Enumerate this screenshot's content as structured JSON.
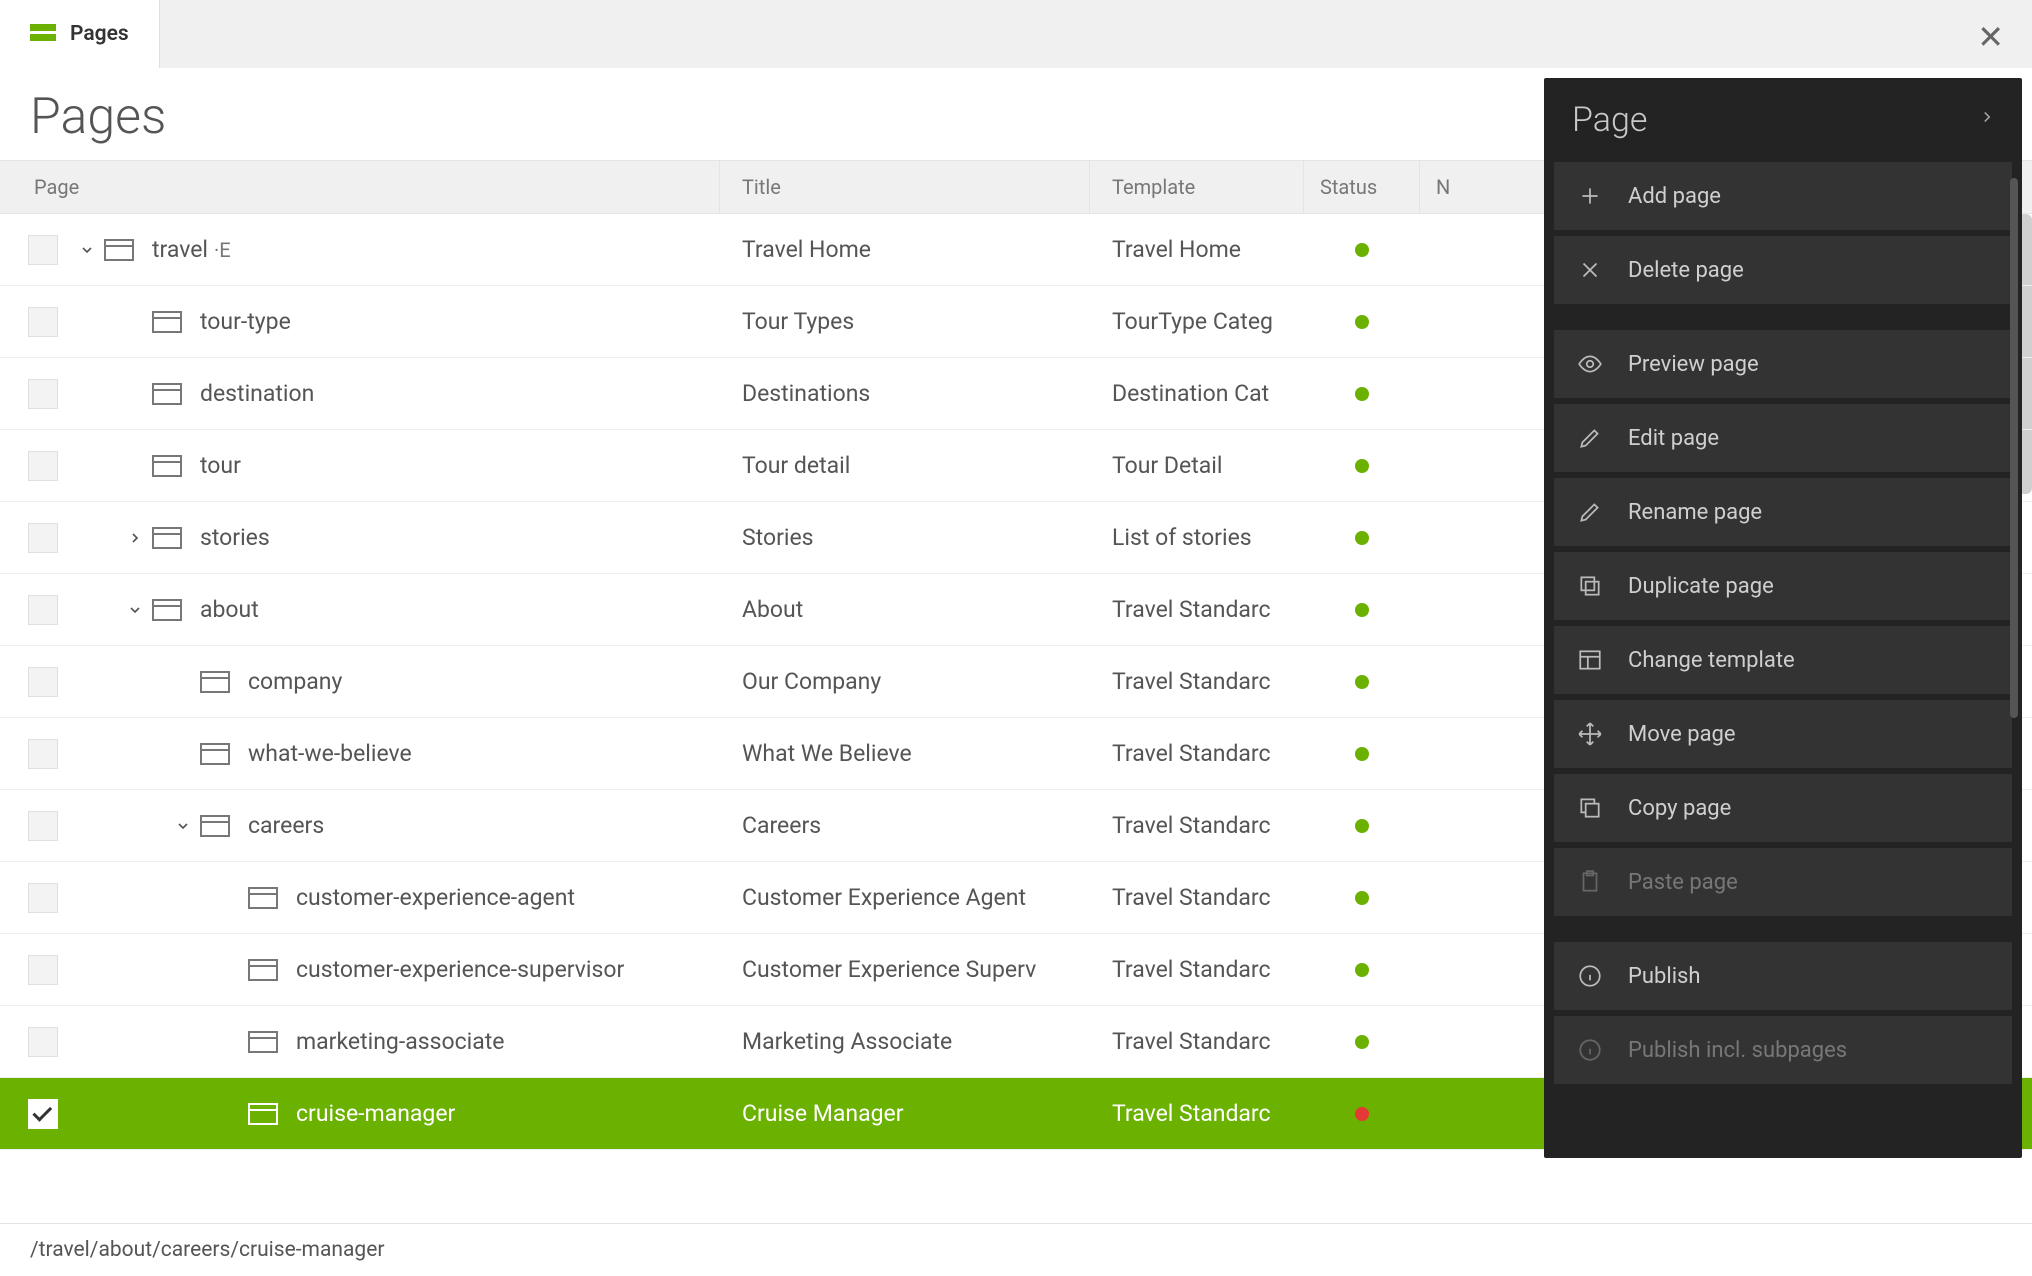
{
  "tab": {
    "label": "Pages"
  },
  "heading": "Pages",
  "columns": {
    "page": "Page",
    "title": "Title",
    "template": "Template",
    "status": "Status",
    "extra": "N"
  },
  "rows": [
    {
      "depth": 0,
      "expander": "down",
      "name": "travel",
      "editing": true,
      "title": "Travel Home",
      "template": "Travel Home",
      "status": "green",
      "selected": false
    },
    {
      "depth": 1,
      "expander": "none",
      "name": "tour-type",
      "title": "Tour Types",
      "template": "TourType Categ",
      "status": "green",
      "selected": false
    },
    {
      "depth": 1,
      "expander": "none",
      "name": "destination",
      "title": "Destinations",
      "template": "Destination Cat",
      "status": "green",
      "selected": false
    },
    {
      "depth": 1,
      "expander": "none",
      "name": "tour",
      "title": "Tour detail",
      "template": "Tour Detail",
      "status": "green",
      "selected": false
    },
    {
      "depth": 1,
      "expander": "right",
      "name": "stories",
      "title": "Stories",
      "template": "List of stories",
      "status": "green",
      "selected": false
    },
    {
      "depth": 1,
      "expander": "down",
      "name": "about",
      "title": "About",
      "template": "Travel Standarc",
      "status": "green",
      "selected": false
    },
    {
      "depth": 2,
      "expander": "none",
      "name": "company",
      "title": "Our Company",
      "template": "Travel Standarc",
      "status": "green",
      "selected": false
    },
    {
      "depth": 2,
      "expander": "none",
      "name": "what-we-believe",
      "title": "What We Believe",
      "template": "Travel Standarc",
      "status": "green",
      "selected": false
    },
    {
      "depth": 2,
      "expander": "down",
      "name": "careers",
      "title": "Careers",
      "template": "Travel Standarc",
      "status": "green",
      "selected": false
    },
    {
      "depth": 3,
      "expander": "none",
      "name": "customer-experience-agent",
      "title": "Customer Experience Agent",
      "template": "Travel Standarc",
      "status": "green",
      "selected": false
    },
    {
      "depth": 3,
      "expander": "none",
      "name": "customer-experience-supervisor",
      "title": "Customer Experience Superv",
      "template": "Travel Standarc",
      "status": "green",
      "selected": false
    },
    {
      "depth": 3,
      "expander": "none",
      "name": "marketing-associate",
      "title": "Marketing Associate",
      "template": "Travel Standarc",
      "status": "green",
      "selected": false
    },
    {
      "depth": 3,
      "expander": "none",
      "name": "cruise-manager",
      "title": "Cruise Manager",
      "template": "Travel Standarc",
      "status": "red",
      "selected": true
    }
  ],
  "footer_path": "/travel/about/careers/cruise-manager",
  "panel": {
    "title": "Page",
    "actions": [
      {
        "icon": "plus",
        "label": "Add page",
        "disabled": false
      },
      {
        "icon": "x",
        "label": "Delete page",
        "disabled": false
      },
      {
        "gap": true
      },
      {
        "icon": "eye",
        "label": "Preview page",
        "disabled": false
      },
      {
        "icon": "pencil",
        "label": "Edit page",
        "disabled": false
      },
      {
        "icon": "pencil",
        "label": "Rename page",
        "disabled": false
      },
      {
        "icon": "duplicate",
        "label": "Duplicate page",
        "disabled": false
      },
      {
        "icon": "template",
        "label": "Change template",
        "disabled": false
      },
      {
        "icon": "move",
        "label": "Move page",
        "disabled": false
      },
      {
        "icon": "copy",
        "label": "Copy page",
        "disabled": false
      },
      {
        "icon": "paste",
        "label": "Paste page",
        "disabled": true
      },
      {
        "gap": true
      },
      {
        "icon": "info",
        "label": "Publish",
        "disabled": false
      },
      {
        "icon": "info",
        "label": "Publish incl. subpages",
        "disabled": true
      }
    ]
  }
}
